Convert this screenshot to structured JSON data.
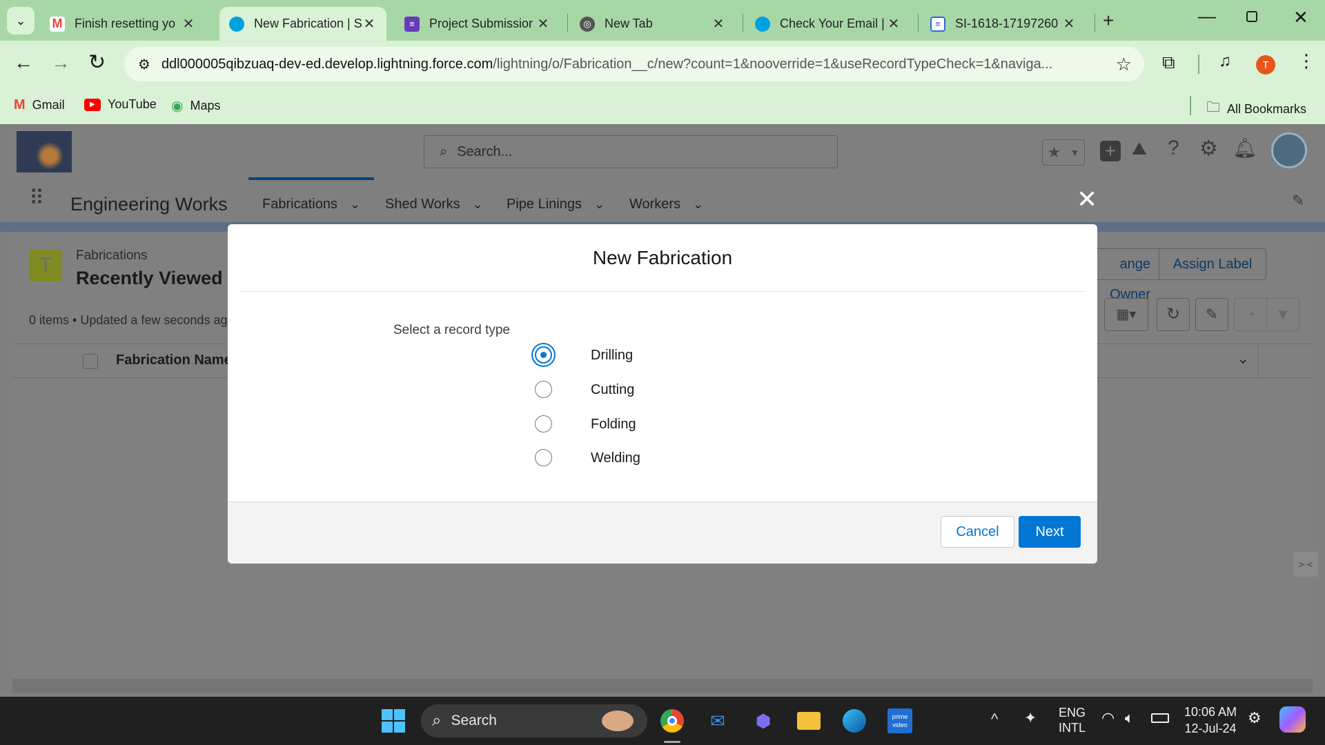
{
  "browser": {
    "tabs": [
      {
        "title": "Finish resetting yo",
        "icon": "gmail-icon"
      },
      {
        "title": "New Fabrication | S",
        "icon": "salesforce-icon"
      },
      {
        "title": "Project Submissior",
        "icon": "forms-icon"
      },
      {
        "title": "New Tab",
        "icon": "chrome-icon"
      },
      {
        "title": "Check Your Email |",
        "icon": "salesforce-icon"
      },
      {
        "title": "SI-1618-17197260",
        "icon": "doc-icon"
      }
    ],
    "url_host": "ddl000005qibzuaq-dev-ed.develop.lightning.force.com",
    "url_path": "/lightning/o/Fabrication__c/new?count=1&nooverride=1&useRecordTypeCheck=1&naviga...",
    "profile_initial": "T",
    "bookmarks": [
      "Gmail",
      "YouTube",
      "Maps"
    ],
    "all_bookmarks": "All Bookmarks"
  },
  "app": {
    "search_placeholder": "Search...",
    "name": "Engineering Works",
    "nav_tabs": [
      "Fabrications",
      "Shed Works",
      "Pipe Linings",
      "Workers"
    ]
  },
  "list": {
    "object_label": "Fabrications",
    "view_name": "Recently Viewed",
    "status": "0 items • Updated a few seconds ag",
    "column_header": "Fabrication Name",
    "change_owner": "ange Owner",
    "assign_label": "Assign Label"
  },
  "modal": {
    "title": "New Fabrication",
    "prompt": "Select a record type",
    "options": [
      "Drilling",
      "Cutting",
      "Folding",
      "Welding"
    ],
    "selected": "Drilling",
    "cancel": "Cancel",
    "next": "Next"
  },
  "taskbar": {
    "search": "Search",
    "lang1": "ENG",
    "lang2": "INTL",
    "time": "10:06 AM",
    "date": "12-Jul-24"
  },
  "colors": {
    "accent": "#0176d3",
    "chrome_green": "#d9f2d5"
  }
}
